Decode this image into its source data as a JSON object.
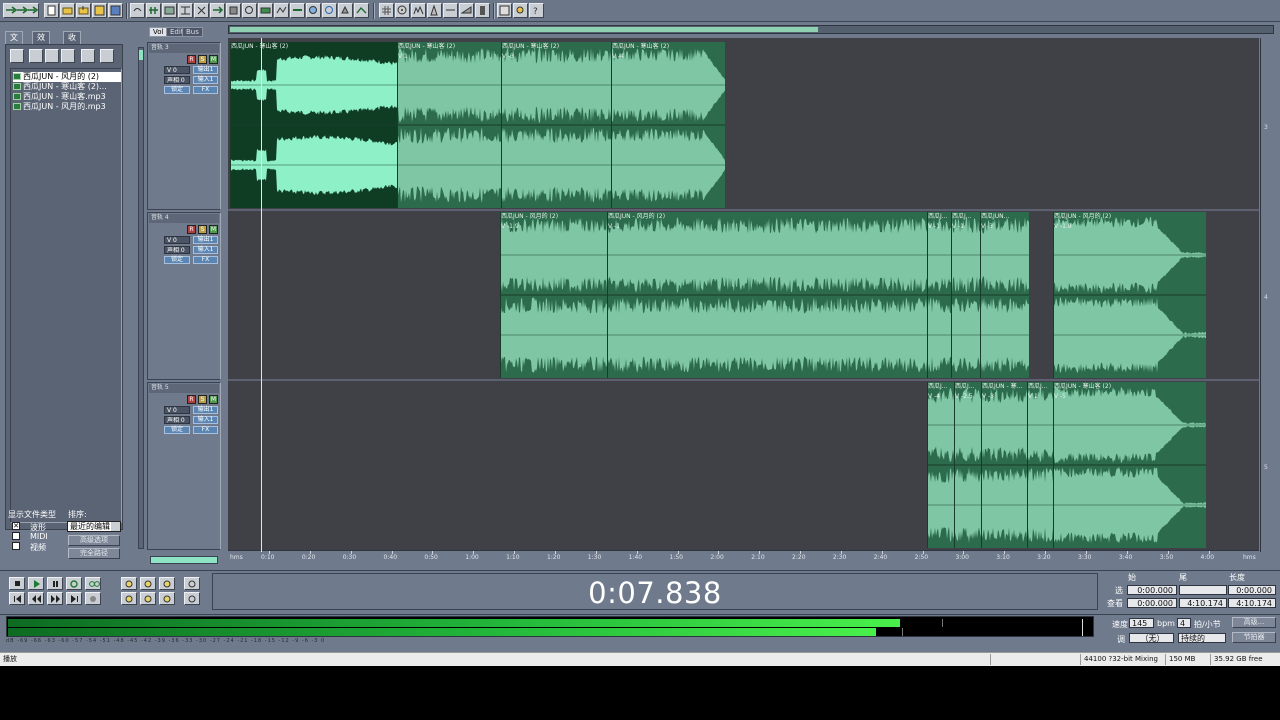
{
  "toolbar": {
    "icons": [
      "multitrack-view-icon",
      "new-icon",
      "open-icon",
      "open-append-icon",
      "save-icon",
      "save-as-icon",
      "undo-icon",
      "mix-icon",
      "edit-view-icon",
      "snap-icon",
      "cut-icon",
      "trim-icon",
      "insert-icon",
      "split-icon",
      "loop-icon",
      "scrub-icon",
      "zoom-icon",
      "time-select-icon",
      "hybrid-tool-icon",
      "move-copy-icon",
      "envelope-icon",
      "grid-icon",
      "cd-icon",
      "spectral-icon",
      "metronome-icon",
      "pan-icon",
      "volume-icon",
      "fx-icon",
      "settings-icon",
      "help-icon"
    ]
  },
  "organizer": {
    "tabs": [
      "文件",
      "效果",
      "收藏"
    ],
    "files": [
      "西瓜JUN - 风月的 (2)",
      "西瓜JUN - 寒山客 (2)...",
      "西瓜JUN - 寒山客.mp3",
      "西瓜JUN - 风月的.mp3"
    ],
    "show_types_label": "显示文件类型",
    "sort_label": "排序:",
    "types": [
      "波形",
      "MIDI",
      "视频"
    ],
    "sort_value": "最近的编辑",
    "btn_advanced": "高级选项",
    "btn_full_path": "完全路径"
  },
  "view_tabs": [
    "Vol",
    "Edit",
    "Bus"
  ],
  "tracks": [
    {
      "name": "音轨 3",
      "vol": "V 0",
      "pan": "声相 0",
      "out1": "输出1",
      "in1": "输入1",
      "lock": "锁定",
      "fx": "FX"
    },
    {
      "name": "音轨 4",
      "vol": "V 0",
      "pan": "声相 0",
      "out1": "输出1",
      "in1": "输入1",
      "lock": "锁定",
      "fx": "FX"
    },
    {
      "name": "音轨 5",
      "vol": "V 0",
      "pan": "声相 0",
      "out1": "输出1",
      "in1": "输入1",
      "lock": "锁定",
      "fx": "FX"
    }
  ],
  "clips": {
    "t1c1": {
      "name": "西瓜JUN - 寒山客 (2)",
      "vol": ""
    },
    "t1c2": {
      "name": "西瓜JUN - 寒山客 (2)",
      "vol": "V 1"
    },
    "t1c3": {
      "name": "西瓜JUN - 寒山客 (2)",
      "vol": "V -3"
    },
    "t1c4": {
      "name": "西瓜JUN - 寒山客 (2)",
      "vol": "V -4"
    },
    "t2c1": {
      "name": "西瓜JUN - 风月的 (2)",
      "vol": "V -1.9"
    },
    "t2c2": {
      "name": "西瓜JUN - 风月的 (2)",
      "vol": "V -1"
    },
    "t2c3": {
      "name": "西瓜J...",
      "vol": "V -1"
    },
    "t2c4": {
      "name": "西瓜J...",
      "vol": "V -1"
    },
    "t2c5": {
      "name": "西瓜JUN...",
      "vol": "V -3"
    },
    "t2c6": {
      "name": "西瓜JUN - 风月的 (2)",
      "vol": "V -1.8"
    },
    "t3c1": {
      "name": "西瓜J...",
      "vol": "V -4"
    },
    "t3c2": {
      "name": "西瓜J...",
      "vol": "V -2.5"
    },
    "t3c3": {
      "name": "西瓜JUN - 寒...",
      "vol": "V -3"
    },
    "t3c4": {
      "name": "西瓜J...",
      "vol": "V 1"
    },
    "t3c5": {
      "name": "西瓜JUN - 寒山客 (2)",
      "vol": "V -5"
    }
  },
  "ruler": {
    "start": "hms",
    "end": "hms",
    "labels": [
      "0:10",
      "0:20",
      "0:30",
      "0:40",
      "0:50",
      "1:00",
      "1:10",
      "1:20",
      "1:30",
      "1:40",
      "1:50",
      "2:00",
      "2:10",
      "2:20",
      "2:30",
      "2:40",
      "2:50",
      "3:00",
      "3:10",
      "3:20",
      "3:30",
      "3:40",
      "3:50",
      "4:00"
    ]
  },
  "right_ticks": [
    "3",
    "4",
    "5"
  ],
  "transport": {
    "time": "0:07.838",
    "icons": [
      "stop-icon",
      "play-icon",
      "pause-icon",
      "play-to-end-icon",
      "loop-icon",
      "go-start-icon",
      "rewind-icon",
      "fast-forward-icon",
      "go-end-icon",
      "record-icon",
      "zoom-in-h-icon",
      "zoom-out-h-icon",
      "zoom-full-icon",
      "zoom-in-v-icon",
      "zoom-sel-icon",
      "zoom-left-icon",
      "zoom-right-icon",
      "zoom-out-v-icon"
    ]
  },
  "selection": {
    "col_start": "始",
    "col_end": "尾",
    "col_length": "长度",
    "row_sel": "选",
    "row_view": "查看",
    "sel_start": "0:00.000",
    "sel_end": "",
    "sel_length": "0:00.000",
    "view_start": "0:00.000",
    "view_end": "4:10.174",
    "view_length": "4:10.174"
  },
  "meter": {
    "level_top": 0.832,
    "level_bottom": 0.81,
    "scale": "dB -69 -66 -63 -60 -57 -54 -51 -48 -45 -42 -39 -36 -33 -30 -27 -24 -21 -18 -15 -12 -9 -6 -3 0"
  },
  "tempo": {
    "tempo_label": "速度",
    "tempo_value": "145",
    "bpm": "bpm",
    "beats_value": "4",
    "beats_label": "拍/小节",
    "key_label": "调",
    "key_value": "（无）",
    "time_sig_value": "持续的",
    "btn_advanced": "高级...",
    "btn_metronome": "节拍器"
  },
  "status": {
    "left": "播放",
    "format": "44100 ?32-bit Mixing",
    "memory": "150 MB",
    "free": "35.92 GB free"
  }
}
